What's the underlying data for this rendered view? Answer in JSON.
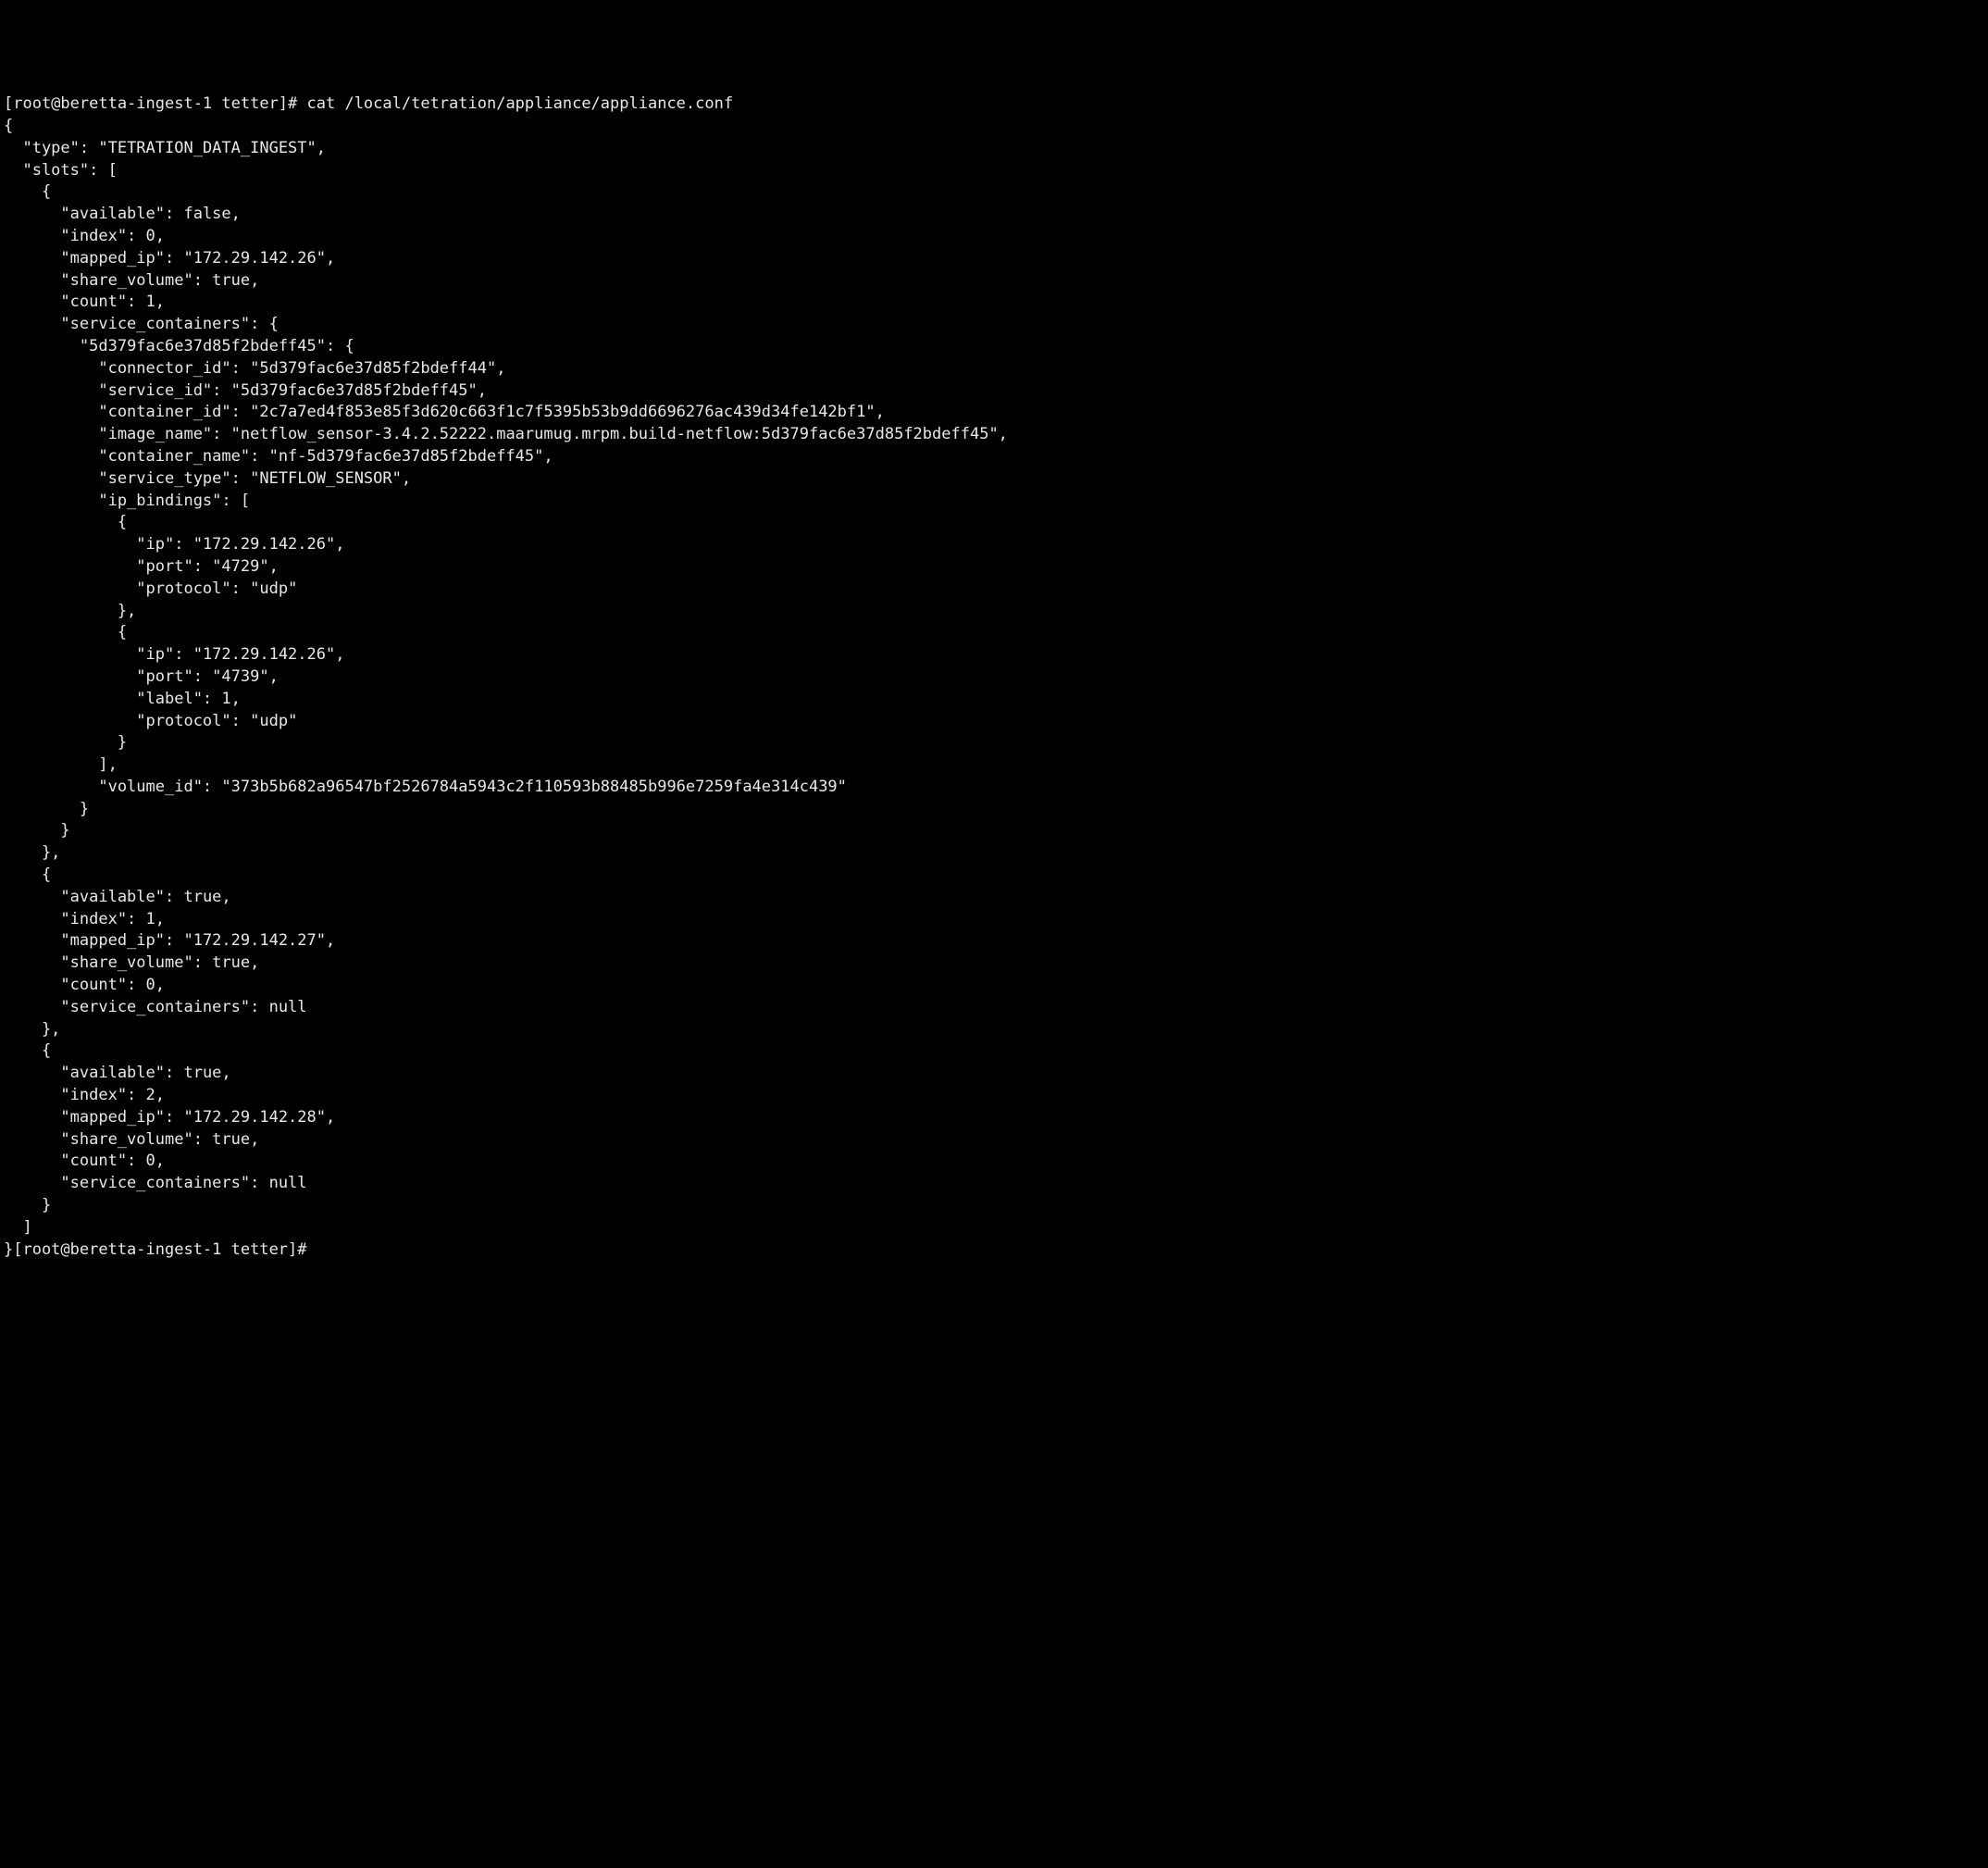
{
  "terminal": {
    "prompt_user": "[root@beretta-ingest-1 tetter]#",
    "command": " cat /local/tetration/appliance/appliance.conf",
    "json_output": {
      "type": "TETRATION_DATA_INGEST",
      "slots": [
        {
          "available": false,
          "index": 0,
          "mapped_ip": "172.29.142.26",
          "share_volume": true,
          "count": 1,
          "service_containers": {
            "key": "5d379fac6e37d85f2bdeff45",
            "connector_id": "5d379fac6e37d85f2bdeff44",
            "service_id": "5d379fac6e37d85f2bdeff45",
            "container_id": "2c7a7ed4f853e85f3d620c663f1c7f5395b53b9dd6696276ac439d34fe142bf1",
            "image_name": "netflow_sensor-3.4.2.52222.maarumug.mrpm.build-netflow:5d379fac6e37d85f2bdeff45",
            "container_name": "nf-5d379fac6e37d85f2bdeff45",
            "service_type": "NETFLOW_SENSOR",
            "ip_bindings": [
              {
                "ip": "172.29.142.26",
                "port": "4729",
                "protocol": "udp"
              },
              {
                "ip": "172.29.142.26",
                "port": "4739",
                "label": 1,
                "protocol": "udp"
              }
            ],
            "volume_id": "373b5b682a96547bf2526784a5943c2f110593b88485b996e7259fa4e314c439"
          }
        },
        {
          "available": true,
          "index": 1,
          "mapped_ip": "172.29.142.27",
          "share_volume": true,
          "count": 0,
          "service_containers": null
        },
        {
          "available": true,
          "index": 2,
          "mapped_ip": "172.29.142.28",
          "share_volume": true,
          "count": 0,
          "service_containers": null
        }
      ]
    },
    "prompt_end": "}[root@beretta-ingest-1 tetter]# "
  }
}
